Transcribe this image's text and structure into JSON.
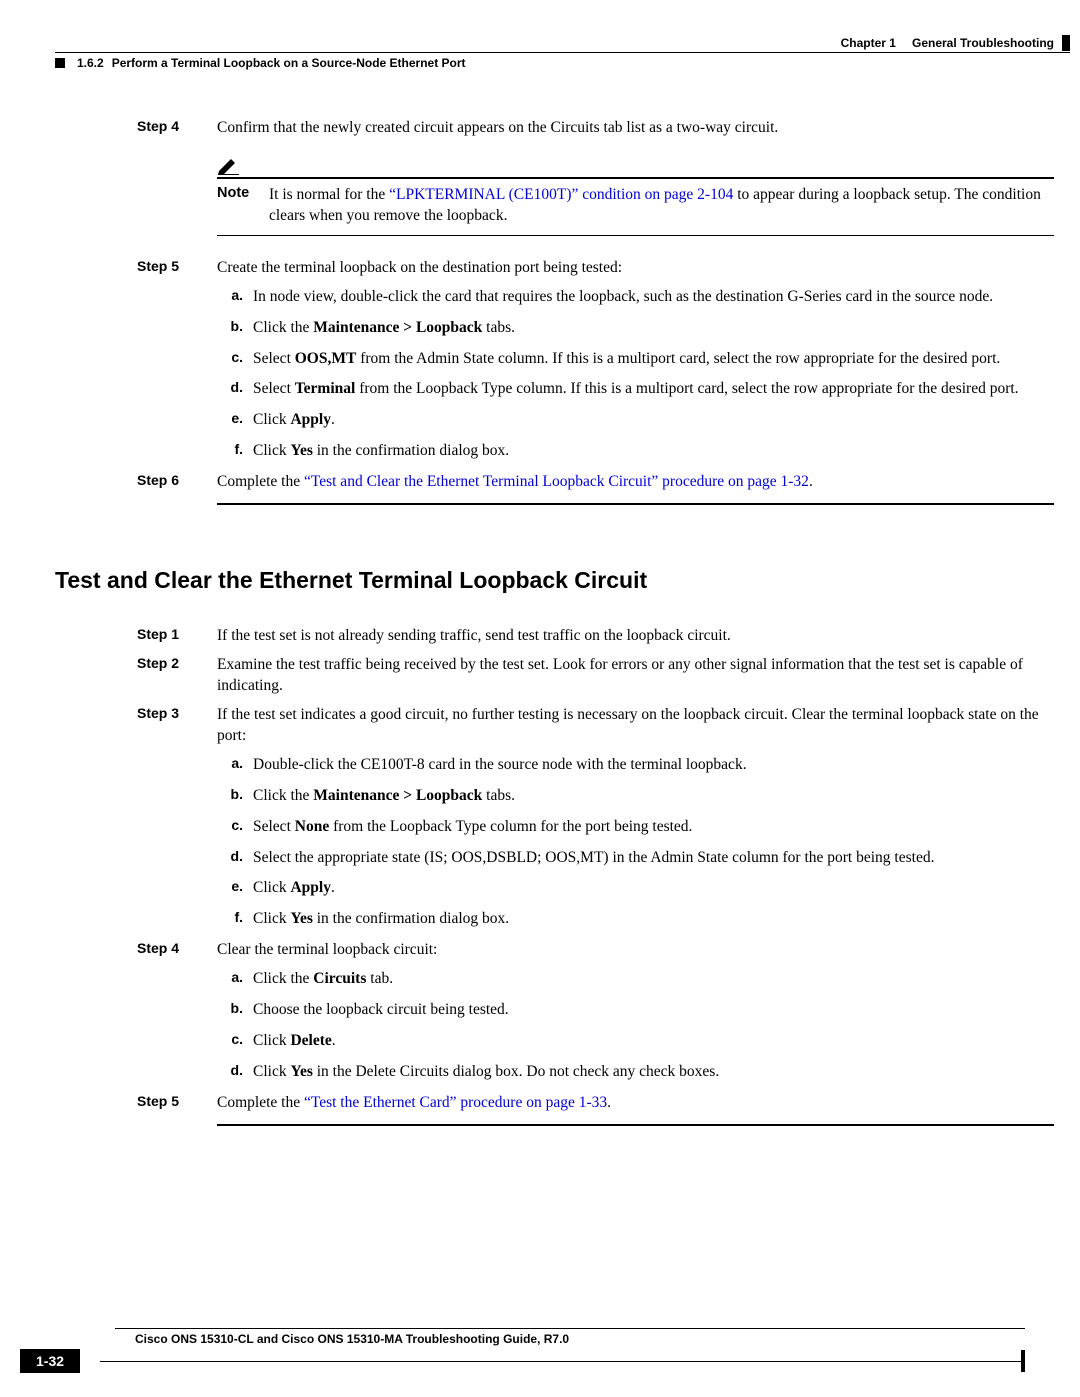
{
  "header": {
    "chapter_label": "Chapter 1",
    "chapter_title": "General Troubleshooting",
    "section_num": "1.6.2",
    "section_title": "Perform a Terminal Loopback on a Source-Node Ethernet Port"
  },
  "section1": {
    "step4": {
      "label": "Step 4",
      "text": "Confirm that the newly created circuit appears on the Circuits tab list as a two-way circuit."
    },
    "note": {
      "label": "Note",
      "pre": "It is normal for the ",
      "link": "“LPKTERMINAL (CE100T)” condition on page 2-104",
      "post": " to appear during a loopback setup. The condition clears when you remove the loopback."
    },
    "step5": {
      "label": "Step 5",
      "intro": "Create the terminal loopback on the destination port being tested:",
      "a": {
        "l": "a.",
        "t": "In node view, double-click the card that requires the loopback, such as the destination G-Series card in the source node."
      },
      "b": {
        "l": "b.",
        "p": "Click the ",
        "b": "Maintenance > Loopback",
        "s": " tabs."
      },
      "c": {
        "l": "c.",
        "p1": "Select ",
        "b1": "OOS,MT",
        "p2": " from the Admin State column. If this is a multiport card, select the row appropriate for the desired port."
      },
      "d": {
        "l": "d.",
        "p1": "Select ",
        "b1": "Terminal",
        "p2": " from the Loopback Type column. If this is a multiport card, select the row appropriate for the desired port."
      },
      "e": {
        "l": "e.",
        "p": "Click ",
        "b": "Apply",
        "s": "."
      },
      "f": {
        "l": "f.",
        "p": "Click ",
        "b": "Yes",
        "s": " in the confirmation dialog box."
      }
    },
    "step6": {
      "label": "Step 6",
      "pre": "Complete the ",
      "link": "“Test and Clear the Ethernet Terminal Loopback Circuit” procedure on page 1-32",
      "post": "."
    }
  },
  "h2": "Test and Clear the Ethernet Terminal Loopback Circuit",
  "section2": {
    "step1": {
      "label": "Step 1",
      "text": "If the test set is not already sending traffic, send test traffic on the loopback circuit."
    },
    "step2": {
      "label": "Step 2",
      "text": "Examine the test traffic being received by the test set. Look for errors or any other signal information that the test set is capable of indicating."
    },
    "step3": {
      "label": "Step 3",
      "intro": "If the test set indicates a good circuit, no further testing is necessary on the loopback circuit. Clear the terminal loopback state on the port:",
      "a": {
        "l": "a.",
        "t": "Double-click the CE100T-8 card in the source node with the terminal loopback."
      },
      "b": {
        "l": "b.",
        "p": "Click the ",
        "b": "Maintenance > Loopback",
        "s": " tabs."
      },
      "c": {
        "l": "c.",
        "p1": "Select ",
        "b1": "None",
        "p2": " from the Loopback Type column for the port being tested."
      },
      "d": {
        "l": "d.",
        "t": "Select the appropriate state (IS; OOS,DSBLD; OOS,MT) in the Admin State column for the port being tested."
      },
      "e": {
        "l": "e.",
        "p": "Click ",
        "b": "Apply",
        "s": "."
      },
      "f": {
        "l": "f.",
        "p": "Click ",
        "b": "Yes",
        "s": " in the confirmation dialog box."
      }
    },
    "step4": {
      "label": "Step 4",
      "intro": "Clear the terminal loopback circuit:",
      "a": {
        "l": "a.",
        "p": "Click the ",
        "b": "Circuits",
        "s": " tab."
      },
      "b": {
        "l": "b.",
        "t": "Choose the loopback circuit being tested."
      },
      "c": {
        "l": "c.",
        "p": "Click ",
        "b": "Delete",
        "s": "."
      },
      "d": {
        "l": "d.",
        "p": "Click ",
        "b": "Yes",
        "s": " in the Delete Circuits dialog box. Do not check any check boxes."
      }
    },
    "step5": {
      "label": "Step 5",
      "pre": "Complete the ",
      "link": "“Test the Ethernet Card” procedure on page 1-33",
      "post": "."
    }
  },
  "footer": {
    "title": "Cisco ONS 15310-CL and Cisco ONS 15310-MA Troubleshooting Guide, R7.0",
    "page": "1-32"
  }
}
